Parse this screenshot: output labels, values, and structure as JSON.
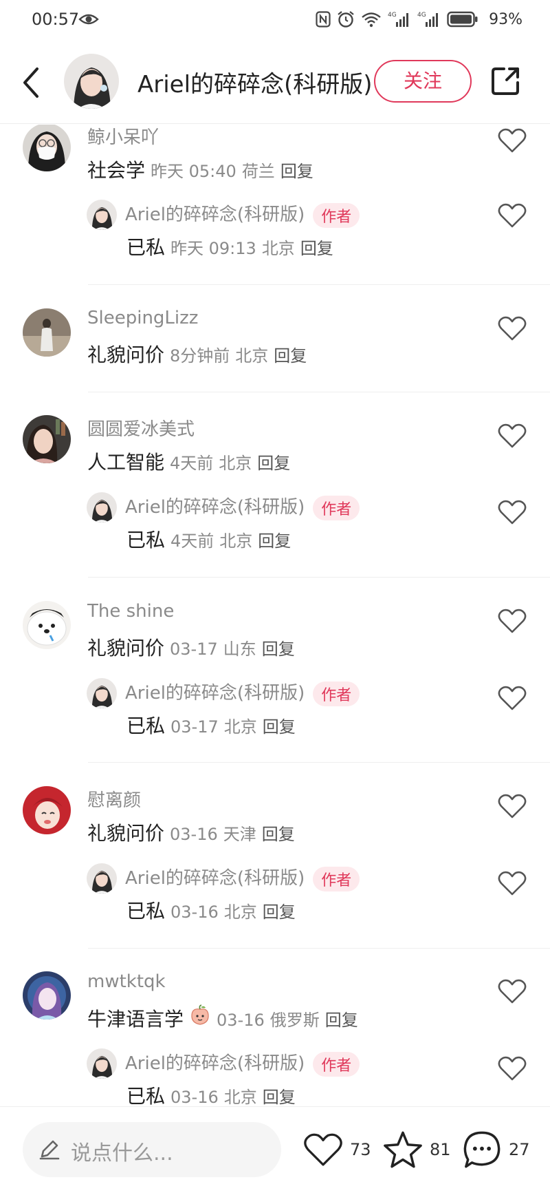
{
  "status_bar": {
    "time": "00:57",
    "battery_pct": "93%",
    "icons": [
      "eye-icon",
      "nfc-icon",
      "alarm-icon",
      "wifi-icon",
      "4g-signal-icon",
      "4g-signal-icon",
      "battery-icon"
    ]
  },
  "header": {
    "title": "Ariel的碎碎念(科研版)",
    "follow_label": "关注",
    "back_icon": "chevron-left-icon",
    "share_icon": "share-icon",
    "accent_color": "#e0385a"
  },
  "comments": [
    {
      "name": "鲸小呆吖",
      "text": "社会学",
      "time": "昨天 05:40",
      "location": "荷兰",
      "reply_label": "回复",
      "reply": {
        "name": "Ariel的碎碎念(科研版)",
        "badge": "作者",
        "text": "已私",
        "time": "昨天 09:13",
        "location": "北京",
        "reply_label": "回复"
      }
    },
    {
      "name": "SleepingLizz",
      "text": "礼貌问价",
      "time": "8分钟前",
      "location": "北京",
      "reply_label": "回复"
    },
    {
      "name": "圆圆爱冰美式",
      "text": "人工智能",
      "time": "4天前",
      "location": "北京",
      "reply_label": "回复",
      "reply": {
        "name": "Ariel的碎碎念(科研版)",
        "badge": "作者",
        "text": "已私",
        "time": "4天前",
        "location": "北京",
        "reply_label": "回复"
      }
    },
    {
      "name": "The  shine",
      "text": "礼貌问价",
      "time": "03-17",
      "location": "山东",
      "reply_label": "回复",
      "reply": {
        "name": "Ariel的碎碎念(科研版)",
        "badge": "作者",
        "text": "已私",
        "time": "03-17",
        "location": "北京",
        "reply_label": "回复"
      }
    },
    {
      "name": "慰离颜",
      "text": "礼貌问价",
      "time": "03-16",
      "location": "天津",
      "reply_label": "回复",
      "reply": {
        "name": "Ariel的碎碎念(科研版)",
        "badge": "作者",
        "text": "已私",
        "time": "03-16",
        "location": "北京",
        "reply_label": "回复"
      }
    },
    {
      "name": "mwtktqk",
      "text": "牛津语言学",
      "emoji": "peach-emoji",
      "time": "03-16",
      "location": "俄罗斯",
      "reply_label": "回复",
      "reply": {
        "name": "Ariel的碎碎念(科研版)",
        "badge": "作者",
        "text": "已私",
        "time": "03-16",
        "location": "北京",
        "reply_label": "回复"
      }
    }
  ],
  "bottom_bar": {
    "input_placeholder": "说点什么...",
    "likes": "73",
    "favorites": "81",
    "comments": "27"
  }
}
